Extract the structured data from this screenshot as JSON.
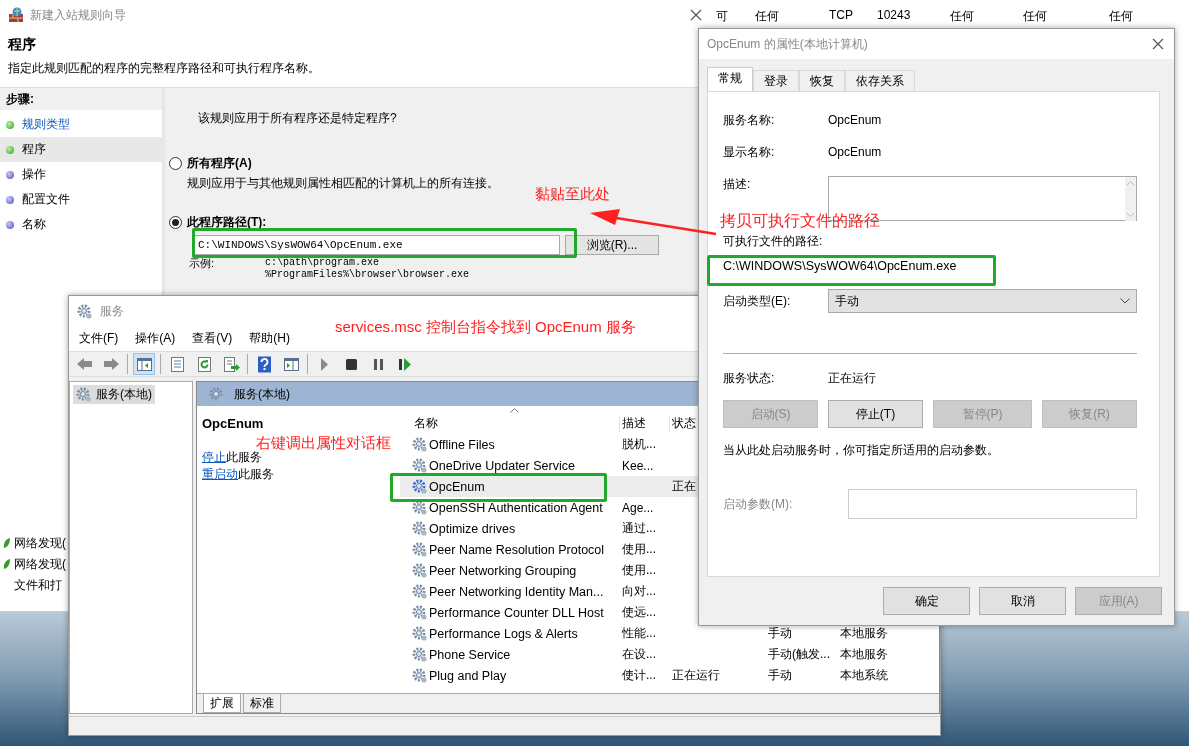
{
  "background_window": {
    "table_row": [
      "可",
      "任何",
      "TCP",
      "10243",
      "任何",
      "任何",
      "任何"
    ],
    "list_items": [
      {
        "label": "网络发现(",
        "enabled": true
      },
      {
        "label": "网络发现(",
        "enabled": true
      },
      {
        "label": "文件和打",
        "enabled": false
      }
    ]
  },
  "wizard": {
    "title": "新建入站规则向导",
    "heading": "程序",
    "subtitle": "指定此规则匹配的程序的完整程序路径和可执行程序名称。",
    "steps_label": "步骤:",
    "steps": [
      {
        "label": "规则类型",
        "completed": true,
        "selected": false
      },
      {
        "label": "程序",
        "completed": true,
        "selected": true
      },
      {
        "label": "操作",
        "completed": false,
        "selected": false
      },
      {
        "label": "配置文件",
        "completed": false,
        "selected": false
      },
      {
        "label": "名称",
        "completed": false,
        "selected": false
      }
    ],
    "question": "该规则应用于所有程序还是特定程序?",
    "options": [
      {
        "label": "所有程序(A)",
        "description": "规则应用于与其他规则属性相匹配的计算机上的所有连接。",
        "selected": false
      },
      {
        "label": "此程序路径(T):",
        "selected": true
      }
    ],
    "path_value": "C:\\WINDOWS\\SysWOW64\\OpcEnum.exe",
    "browse_button": "浏览(R)...",
    "example_label": "示例:",
    "examples": [
      "c:\\path\\program.exe",
      "%ProgramFiles%\\browser\\browser.exe"
    ]
  },
  "services": {
    "title": "服务",
    "menu": [
      "文件(F)",
      "操作(A)",
      "查看(V)",
      "帮助(H)"
    ],
    "tree_item": "服务(本地)",
    "pane_title": "服务(本地)",
    "service_name": "OpcEnum",
    "actions": [
      {
        "link": "停止",
        "text": "此服务"
      },
      {
        "link": "重启动",
        "text": "此服务"
      }
    ],
    "columns": [
      "名称",
      "描述",
      "状态"
    ],
    "rows": [
      {
        "name": "Offline Files",
        "description": "脱机...",
        "selected": false
      },
      {
        "name": "OneDrive Updater Service",
        "description": "Kee...",
        "selected": false
      },
      {
        "name": "OpcEnum",
        "status": "正在",
        "selected": true
      },
      {
        "name": "OpenSSH Authentication Agent",
        "description": "Age...",
        "selected": false
      },
      {
        "name": "Optimize drives",
        "description": "通过...",
        "selected": false
      },
      {
        "name": "Peer Name Resolution Protocol",
        "description": "使用...",
        "selected": false
      },
      {
        "name": "Peer Networking Grouping",
        "description": "使用...",
        "selected": false
      },
      {
        "name": "Peer Networking Identity Man...",
        "description": "向对...",
        "selected": false
      },
      {
        "name": "Performance Counter DLL Host",
        "description": "使远...",
        "selected": false
      },
      {
        "name": "Performance Logs & Alerts",
        "description": "性能...",
        "startup": "手动",
        "logon": "本地服务",
        "selected": false
      },
      {
        "name": "Phone Service",
        "description": "在设...",
        "startup": "手动(触发...",
        "logon": "本地服务",
        "selected": false
      },
      {
        "name": "Plug and Play",
        "description": "使计...",
        "status": "正在运行",
        "startup": "手动",
        "logon": "本地系统",
        "selected": false
      }
    ],
    "view_tabs": [
      {
        "label": "扩展",
        "selected": true
      },
      {
        "label": "标准",
        "selected": false
      }
    ]
  },
  "dialog": {
    "title": "OpcEnum 的属性(本地计算机)",
    "tabs": [
      {
        "label": "常规",
        "selected": true
      },
      {
        "label": "登录",
        "selected": false
      },
      {
        "label": "恢复",
        "selected": false
      },
      {
        "label": "依存关系",
        "selected": false
      }
    ],
    "fields": [
      {
        "label": "服务名称:",
        "value": "OpcEnum"
      },
      {
        "label": "显示名称:",
        "value": "OpcEnum"
      }
    ],
    "description_label": "描述:",
    "path_label": "可执行文件的路径:",
    "path_value": "C:\\WINDOWS\\SysWOW64\\OpcEnum.exe",
    "startup_type_label": "启动类型(E):",
    "startup_type_value": "手动",
    "status_label": "服务状态:",
    "status_value": "正在运行",
    "control_buttons": [
      {
        "label": "启动(S)",
        "disabled": true
      },
      {
        "label": "停止(T)",
        "disabled": false
      },
      {
        "label": "暂停(P)",
        "disabled": true
      },
      {
        "label": "恢复(R)",
        "disabled": true
      }
    ],
    "hint": "当从此处启动服务时，你可指定所适用的启动参数。",
    "params_label": "启动参数(M):",
    "params_disabled": true,
    "buttons": [
      {
        "label": "确定",
        "disabled": false
      },
      {
        "label": "取消",
        "disabled": false
      },
      {
        "label": "应用(A)",
        "disabled": true
      }
    ]
  },
  "annotations": [
    {
      "text": "黏贴至此处"
    },
    {
      "text": "拷贝可执行文件的路径"
    },
    {
      "text": "services.msc 控制台指令找到 OpcEnum 服务"
    },
    {
      "text": "右键调出属性对话框"
    }
  ]
}
